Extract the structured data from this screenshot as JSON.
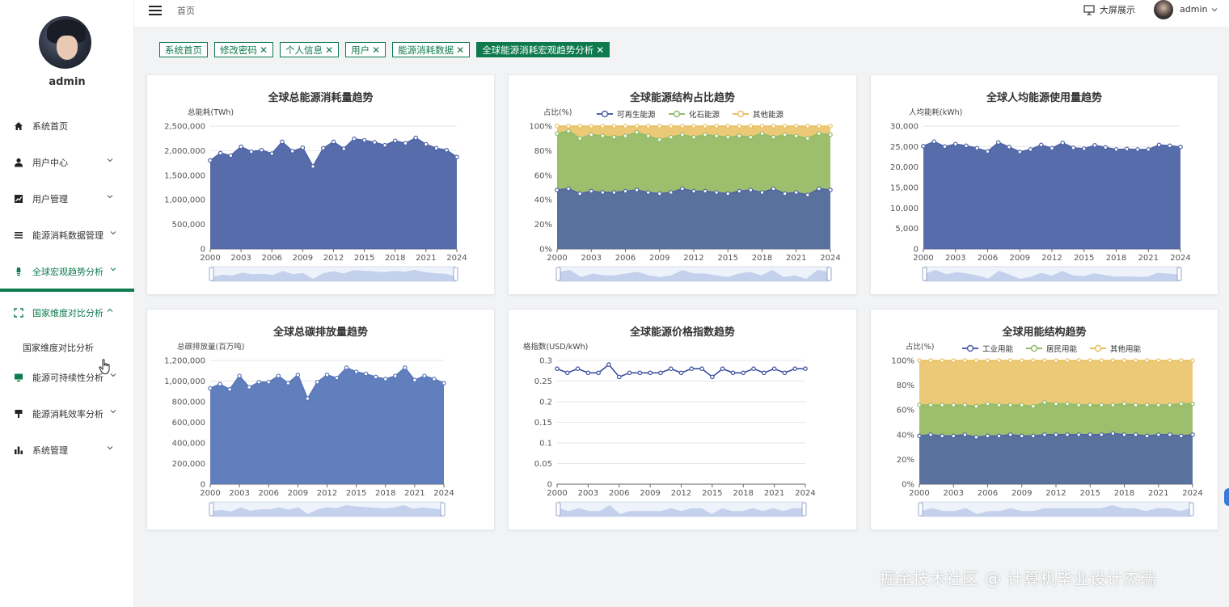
{
  "user": {
    "name": "admin"
  },
  "sidebar": {
    "items": [
      {
        "label": "系统首页",
        "icon": "home-icon"
      },
      {
        "label": "用户中心",
        "icon": "user-icon"
      },
      {
        "label": "用户管理",
        "icon": "chart-icon"
      },
      {
        "label": "能源消耗数据管理",
        "icon": "list-icon"
      },
      {
        "label": "全球宏观趋势分析",
        "icon": "bulb-icon"
      },
      {
        "label": "国家维度对比分析",
        "icon": "fullscreen-icon"
      },
      {
        "label": "能源可持续性分析",
        "icon": "monitor-icon"
      },
      {
        "label": "能源消耗效率分析",
        "icon": "brush-icon"
      },
      {
        "label": "系统管理",
        "icon": "bar-icon"
      }
    ],
    "submenu_label": "国家维度对比分析"
  },
  "topbar": {
    "breadcrumb": "首页",
    "bigscreen_label": "大屏展示",
    "user": "admin"
  },
  "tags": [
    {
      "label": "系统首页",
      "closable": false
    },
    {
      "label": "修改密码",
      "closable": true
    },
    {
      "label": "个人信息",
      "closable": true
    },
    {
      "label": "用户",
      "closable": true
    },
    {
      "label": "能源消耗数据",
      "closable": true
    },
    {
      "label": "全球能源消耗宏观趋势分析",
      "closable": true,
      "active": true
    }
  ],
  "watermark": "掘金技术社区 @ 计算机毕业设计杰瑞",
  "chart_data": [
    {
      "type": "area",
      "title": "全球总能源消耗量趋势",
      "ylabel": "总能耗(TWh)",
      "x": [
        2000,
        2001,
        2002,
        2003,
        2004,
        2005,
        2006,
        2007,
        2008,
        2009,
        2010,
        2011,
        2012,
        2013,
        2014,
        2015,
        2016,
        2017,
        2018,
        2019,
        2020,
        2021,
        2022,
        2023,
        2024
      ],
      "x_ticks": [
        "2000",
        "2003",
        "2006",
        "2009",
        "2012",
        "2015",
        "2018",
        "2021",
        "2024"
      ],
      "y_ticks": [
        "0",
        "500,000",
        "1,000,000",
        "1,500,000",
        "2,000,000",
        "2,500,000"
      ],
      "ylim": [
        0,
        2500000
      ],
      "series": [
        {
          "values": [
            1800000,
            1950000,
            1900000,
            2080000,
            1980000,
            2010000,
            1940000,
            2180000,
            1990000,
            2060000,
            1680000,
            2050000,
            2180000,
            2040000,
            2240000,
            2210000,
            2170000,
            2110000,
            2200000,
            2150000,
            2260000,
            2130000,
            2050000,
            2010000,
            1870000
          ],
          "color": "#4e64a6"
        }
      ]
    },
    {
      "type": "area",
      "stacked": true,
      "title": "全球能源结构占比趋势",
      "ylabel": "占比(%)",
      "legend": [
        "可再生能源",
        "化石能源",
        "其他能源"
      ],
      "legend_position": "top",
      "x": [
        2000,
        2001,
        2002,
        2003,
        2004,
        2005,
        2006,
        2007,
        2008,
        2009,
        2010,
        2011,
        2012,
        2013,
        2014,
        2015,
        2016,
        2017,
        2018,
        2019,
        2020,
        2021,
        2022,
        2023,
        2024
      ],
      "x_ticks": [
        "2000",
        "2003",
        "2006",
        "2009",
        "2012",
        "2015",
        "2018",
        "2021",
        "2024"
      ],
      "y_ticks": [
        "0%",
        "20%",
        "40%",
        "60%",
        "80%",
        "100%"
      ],
      "ylim": [
        0,
        100
      ],
      "series": [
        {
          "name": "可再生能源",
          "values": [
            48,
            49,
            45,
            47,
            46,
            46,
            47,
            48,
            46,
            45,
            46,
            49,
            47,
            47,
            46,
            45,
            47,
            48,
            46,
            49,
            45,
            46,
            44,
            49,
            48
          ],
          "color": "#4e64a6"
        },
        {
          "name": "化石能源",
          "values": [
            94,
            96,
            90,
            93,
            92,
            91,
            92,
            95,
            92,
            89,
            91,
            93,
            91,
            93,
            92,
            91,
            92,
            91,
            94,
            91,
            93,
            92,
            90,
            94,
            93
          ],
          "color": "#8fbc6b"
        },
        {
          "name": "其他能源",
          "values": [
            100,
            100,
            100,
            100,
            100,
            100,
            100,
            100,
            100,
            100,
            100,
            100,
            100,
            100,
            100,
            100,
            100,
            100,
            100,
            100,
            100,
            100,
            100,
            100,
            100
          ],
          "color": "#e9bf5e"
        }
      ]
    },
    {
      "type": "area",
      "title": "全球人均能源使用量趋势",
      "ylabel": "人均能耗(kWh)",
      "x": [
        2000,
        2001,
        2002,
        2003,
        2004,
        2005,
        2006,
        2007,
        2008,
        2009,
        2010,
        2011,
        2012,
        2013,
        2014,
        2015,
        2016,
        2017,
        2018,
        2019,
        2020,
        2021,
        2022,
        2023,
        2024
      ],
      "x_ticks": [
        "2000",
        "2003",
        "2006",
        "2009",
        "2012",
        "2015",
        "2018",
        "2021",
        "2024"
      ],
      "y_ticks": [
        "0",
        "5,000",
        "10,000",
        "15,000",
        "20,000",
        "25,000",
        "30,000"
      ],
      "ylim": [
        0,
        30000
      ],
      "series": [
        {
          "values": [
            25100,
            26200,
            25000,
            25600,
            25200,
            24600,
            23800,
            26000,
            24900,
            23700,
            24300,
            25400,
            24600,
            25900,
            24700,
            24500,
            25300,
            24800,
            24300,
            24400,
            24300,
            24300,
            25400,
            25200,
            24900
          ],
          "color": "#4e64a6"
        }
      ]
    },
    {
      "type": "area",
      "title": "全球总碳排放量趋势",
      "ylabel": "总碳排放量(百万吨)",
      "x": [
        2000,
        2001,
        2002,
        2003,
        2004,
        2005,
        2006,
        2007,
        2008,
        2009,
        2010,
        2011,
        2012,
        2013,
        2014,
        2015,
        2016,
        2017,
        2018,
        2019,
        2020,
        2021,
        2022,
        2023,
        2024
      ],
      "x_ticks": [
        "2000",
        "2003",
        "2006",
        "2009",
        "2012",
        "2015",
        "2018",
        "2021",
        "2024"
      ],
      "y_ticks": [
        "0",
        "200,000",
        "400,000",
        "600,000",
        "800,000",
        "1,000,000",
        "1,200,000"
      ],
      "ylim": [
        0,
        1200000
      ],
      "series": [
        {
          "values": [
            930000,
            970000,
            920000,
            1050000,
            940000,
            990000,
            990000,
            1050000,
            980000,
            1060000,
            830000,
            990000,
            1060000,
            1030000,
            1130000,
            1090000,
            1070000,
            1040000,
            1020000,
            1050000,
            1130000,
            1010000,
            1050000,
            1020000,
            980000
          ],
          "color": "#5877b9"
        }
      ]
    },
    {
      "type": "line",
      "title": "全球能源价格指数趋势",
      "ylabel": "格指数(USD/kWh)",
      "x": [
        2000,
        2001,
        2002,
        2003,
        2004,
        2005,
        2006,
        2007,
        2008,
        2009,
        2010,
        2011,
        2012,
        2013,
        2014,
        2015,
        2016,
        2017,
        2018,
        2019,
        2020,
        2021,
        2022,
        2023,
        2024
      ],
      "x_ticks": [
        "2000",
        "2003",
        "2006",
        "2009",
        "2012",
        "2015",
        "2018",
        "2021",
        "2024"
      ],
      "y_ticks": [
        "0",
        "0.05",
        "0.1",
        "0.15",
        "0.2",
        "0.25",
        "0.3"
      ],
      "ylim": [
        0,
        0.3
      ],
      "series": [
        {
          "values": [
            0.28,
            0.27,
            0.28,
            0.27,
            0.27,
            0.29,
            0.26,
            0.27,
            0.27,
            0.27,
            0.27,
            0.28,
            0.27,
            0.28,
            0.28,
            0.26,
            0.28,
            0.27,
            0.27,
            0.28,
            0.27,
            0.28,
            0.27,
            0.28,
            0.28
          ],
          "color": "#3e4f9e"
        }
      ]
    },
    {
      "type": "area",
      "stacked": true,
      "title": "全球用能结构趋势",
      "ylabel": "占比(%)",
      "legend": [
        "工业用能",
        "居民用能",
        "其他用能"
      ],
      "legend_position": "top",
      "x": [
        2000,
        2001,
        2002,
        2003,
        2004,
        2005,
        2006,
        2007,
        2008,
        2009,
        2010,
        2011,
        2012,
        2013,
        2014,
        2015,
        2016,
        2017,
        2018,
        2019,
        2020,
        2021,
        2022,
        2023,
        2024
      ],
      "x_ticks": [
        "2000",
        "2003",
        "2006",
        "2009",
        "2012",
        "2015",
        "2018",
        "2021",
        "2024"
      ],
      "y_ticks": [
        "0%",
        "20%",
        "40%",
        "60%",
        "80%",
        "100%"
      ],
      "ylim": [
        0,
        100
      ],
      "series": [
        {
          "name": "工业用能",
          "values": [
            39,
            40,
            39,
            39,
            40,
            38,
            39,
            39,
            40,
            39,
            39,
            40,
            40,
            40,
            40,
            40,
            40,
            41,
            40,
            40,
            39,
            40,
            40,
            39,
            40
          ],
          "color": "#4e64a6"
        },
        {
          "name": "居民用能",
          "values": [
            64,
            64,
            64,
            64,
            64,
            63,
            65,
            64,
            64,
            64,
            63,
            66,
            65,
            65,
            64,
            64,
            64,
            64,
            65,
            64,
            64,
            64,
            64,
            65,
            65
          ],
          "color": "#8fbc6b"
        },
        {
          "name": "其他用能",
          "values": [
            100,
            100,
            100,
            100,
            100,
            100,
            100,
            100,
            100,
            100,
            100,
            100,
            100,
            100,
            100,
            100,
            100,
            100,
            100,
            100,
            100,
            100,
            100,
            100,
            100
          ],
          "color": "#e9bf5e"
        }
      ]
    }
  ]
}
